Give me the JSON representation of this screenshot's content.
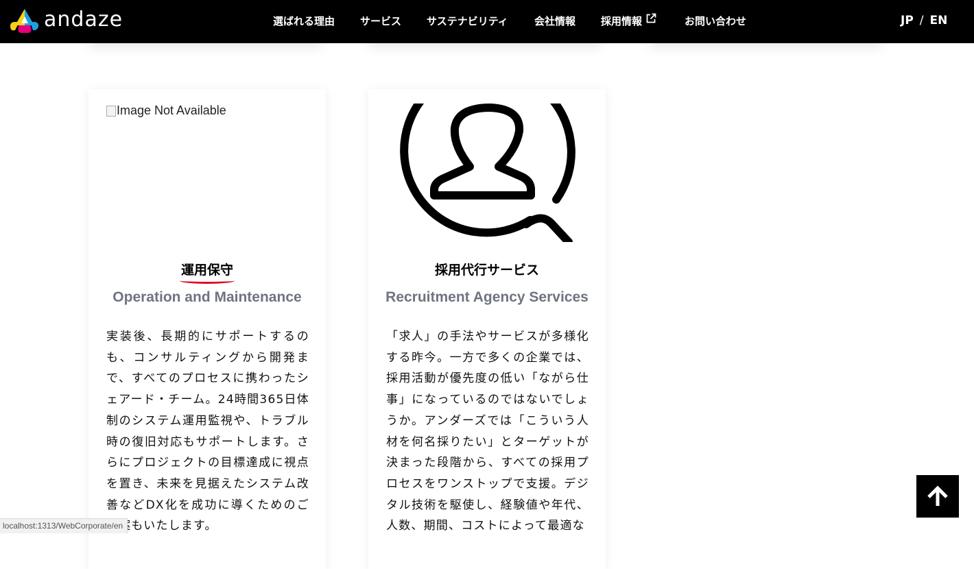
{
  "brand": {
    "logo_text": "andaze",
    "colors": {
      "yellow": "#f7d117",
      "magenta": "#e6007e",
      "cyan": "#1ea0e0",
      "header_bg": "#000000",
      "underline": "#e10a1e",
      "subtitle": "#6f7480"
    }
  },
  "nav": {
    "items": [
      {
        "label": "選ばれる理由"
      },
      {
        "label": "サービス"
      },
      {
        "label": "サステナビリティ"
      },
      {
        "label": "会社情報"
      },
      {
        "label": "採用情報",
        "icon": "external-link-icon"
      },
      {
        "label": "お問い合わせ"
      }
    ]
  },
  "lang": {
    "jp": "JP",
    "sep": "/",
    "en": "EN"
  },
  "cards": [
    {
      "image_alt": "Image Not Available",
      "title": "運用保守",
      "subtitle": "Operation and Maintenance",
      "body": "実装後、長期的にサポートするのも、コンサルティングから開発まで、すべてのプロセスに携わったシェアード・チーム。24時間365日体制のシステム運用監視や、トラブル時の復旧対応もサポートします。さらにプロジェクトの目標達成に視点を置き、未来を見据えたシステム改善などDX化を成功に導くためのご提案もいたします。"
    },
    {
      "icon": "user-search-icon",
      "title": "採用代行サービス",
      "subtitle": "Recruitment Agency Services",
      "body": "「求人」の手法やサービスが多様化する昨今。一方で多くの企業では、採用活動が優先度の低い「ながら仕事」になっているのではないでしょうか。アンダーズでは「こういう人材を何名採りたい」とターゲットが決まった段階から、すべての採用プロセスをワンストップで支援。デジタル技術を駆使し、経験値や年代、人数、期間、コストによって最適な"
    }
  ],
  "back_to_top": {
    "icon": "arrow-up-icon"
  },
  "status_bar": {
    "url": "localhost:1313/WebCorporate/en"
  }
}
